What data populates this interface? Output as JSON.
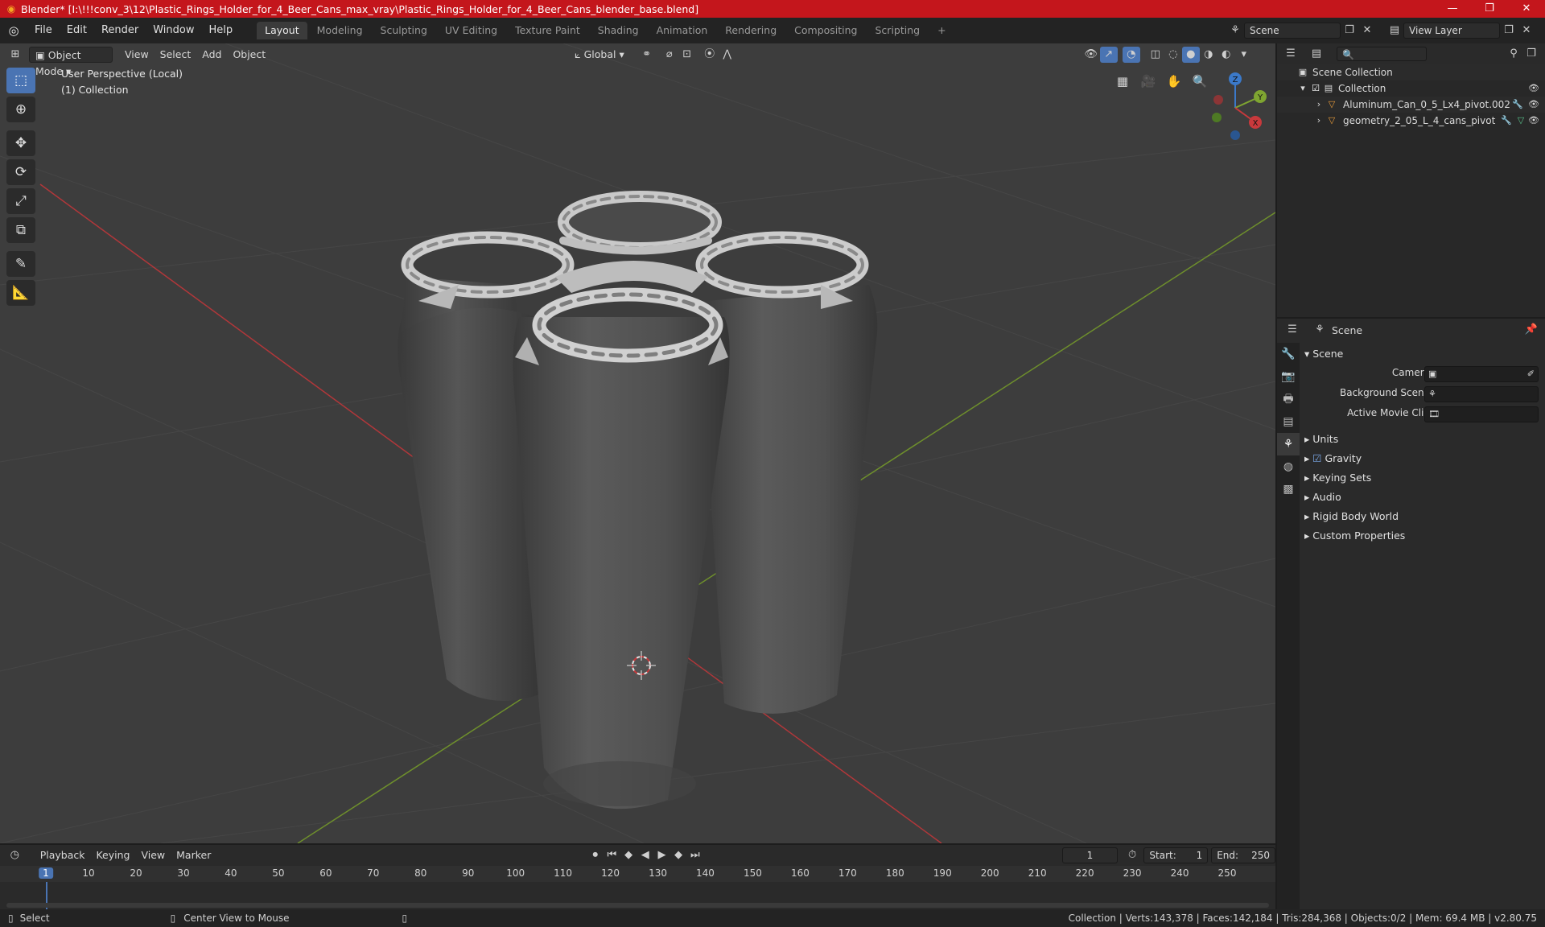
{
  "window": {
    "title": "Blender* [I:\\!!!conv_3\\12\\Plastic_Rings_Holder_for_4_Beer_Cans_max_vray\\Plastic_Rings_Holder_for_4_Beer_Cans_blender_base.blend]",
    "minimize": "—",
    "maximize": "❐",
    "close": "✕"
  },
  "menu": {
    "items": [
      "File",
      "Edit",
      "Render",
      "Window",
      "Help"
    ],
    "workspaces": [
      "Layout",
      "Modeling",
      "Sculpting",
      "UV Editing",
      "Texture Paint",
      "Shading",
      "Animation",
      "Rendering",
      "Compositing",
      "Scripting"
    ],
    "add_tab": "+",
    "scene_value": "Scene",
    "view_layer_value": "View Layer"
  },
  "viewport": {
    "mode": "Object Mode",
    "menus": [
      "View",
      "Select",
      "Add",
      "Object"
    ],
    "orientation": "Global",
    "info_line1": "User Perspective (Local)",
    "info_line2": "(1) Collection",
    "axes": {
      "x": "X",
      "y": "Y",
      "z": "Z"
    }
  },
  "outliner": {
    "search_placeholder": "",
    "root": "Scene Collection",
    "collection": "Collection",
    "objects": [
      "Aluminum_Can_0_5_Lx4_pivot.002",
      "geometry_2_05_L_4_cans_pivot"
    ]
  },
  "properties": {
    "header": "Scene",
    "section": "Scene",
    "camera_label": "Camera",
    "background_label": "Background Scene",
    "clip_label": "Active Movie Clip",
    "subsections": [
      "Units",
      "Gravity",
      "Keying Sets",
      "Audio",
      "Rigid Body World",
      "Custom Properties"
    ]
  },
  "timeline": {
    "menus": [
      "Playback",
      "Keying",
      "View",
      "Marker"
    ],
    "current_frame": "1",
    "start_label": "Start:",
    "start_value": "1",
    "end_label": "End:",
    "end_value": "250",
    "ruler": [
      "1",
      "10",
      "20",
      "30",
      "40",
      "50",
      "60",
      "70",
      "80",
      "90",
      "100",
      "110",
      "120",
      "130",
      "140",
      "150",
      "160",
      "170",
      "180",
      "190",
      "200",
      "210",
      "220",
      "230",
      "240",
      "250"
    ]
  },
  "status": {
    "select": "Select",
    "center": "Center View to Mouse",
    "stats": "Collection | Verts:143,378 | Faces:142,184 | Tris:284,368 | Objects:0/2 | Mem: 69.4 MB | v2.80.75"
  },
  "colors": {
    "titlebar": "#c4161c",
    "accent": "#4a74b3",
    "viewport_bg": "#3d3d3d",
    "x_axis": "#c8393c",
    "y_axis": "#7fa531",
    "z_axis": "#3b79c9",
    "object_icon": "#e89b3a"
  }
}
